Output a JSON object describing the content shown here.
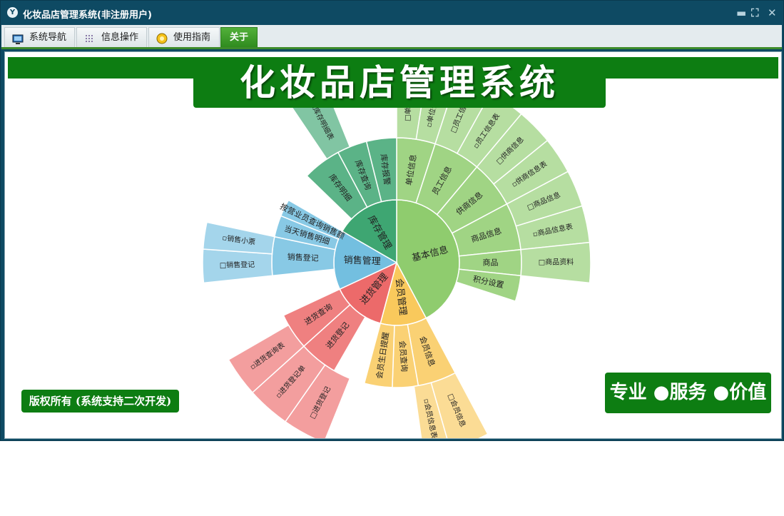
{
  "window": {
    "title": "化妆品店管理系统(非注册用户)",
    "icon_glyph": "Y",
    "controls": {
      "minimize": "▬",
      "restore": "⛶",
      "close": "✕"
    }
  },
  "toolbar": {
    "tabs": [
      {
        "label": "系统导航",
        "icon": "monitor-icon"
      },
      {
        "label": "信息操作",
        "icon": "grid-icon"
      },
      {
        "label": "使用指南",
        "icon": "help-coin-icon"
      },
      {
        "label": "关于",
        "active": true
      }
    ]
  },
  "main": {
    "title": "化妆品店管理系统",
    "copyright": "版权所有 (系统支持二次开发)",
    "slogan": "专业 ●服务 ●价值"
  },
  "colors": {
    "titlebar": "#0e4a63",
    "accent_green": "#0d7d12",
    "basic": "#8fcc6e",
    "member": "#f9c95c",
    "purchase": "#ec6a6a",
    "sales": "#73bfe0",
    "stock": "#3ea672"
  },
  "sunburst": {
    "center_segments": [
      {
        "label": "基本信息",
        "color": "#8fcc6e"
      },
      {
        "label": "会员管理",
        "color": "#f9c95c"
      },
      {
        "label": "进货管理",
        "color": "#ec6a6a"
      },
      {
        "label": "销售管理",
        "color": "#73bfe0"
      },
      {
        "label": "库存管理",
        "color": "#3ea672"
      }
    ],
    "ring2": [
      "单位信息",
      "员工信息",
      "供商信息",
      "商品信息",
      "商品",
      "积分设置",
      "会员信息",
      "会员查询",
      "会员生日提醒",
      "进货登记",
      "进货查询",
      "销售登记",
      "当天销售明细",
      "按营业员查询销售额",
      "库存明细",
      "库存查询",
      "库存报警"
    ],
    "ring3": [
      "□单位信息",
      "▫单位信息表",
      "□员工信息",
      "▫员工信息表",
      "□供商信息",
      "▫供商信息表",
      "□商品信息",
      "▫商品信息表",
      "□商品资料",
      "□会员信息",
      "▫会员信息表",
      "□进货登记",
      "▫进货登记单",
      "▫进货查询表",
      "□销售登记",
      "▫销售小票",
      "▫库存明细表"
    ]
  }
}
